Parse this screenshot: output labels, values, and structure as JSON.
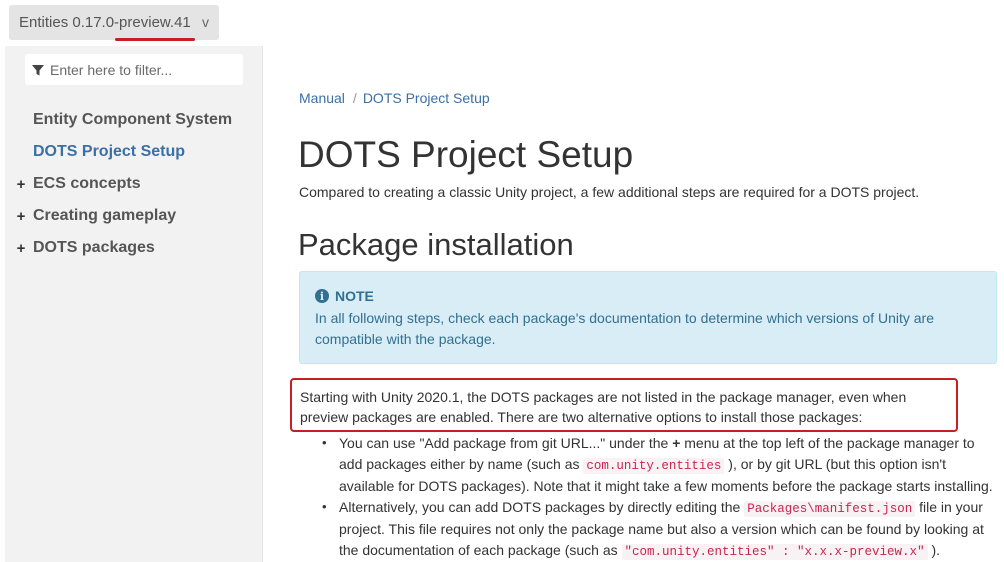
{
  "version_selector": {
    "label": "Entities 0.17.0-preview.41",
    "chevron": "v"
  },
  "sidebar": {
    "filter_placeholder": "Enter here to filter...",
    "items": [
      {
        "label": "Entity Component System",
        "expandable": false,
        "active": false
      },
      {
        "label": "DOTS Project Setup",
        "expandable": false,
        "active": true
      },
      {
        "label": "ECS concepts",
        "expandable": true,
        "active": false
      },
      {
        "label": "Creating gameplay",
        "expandable": true,
        "active": false
      },
      {
        "label": "DOTS packages",
        "expandable": true,
        "active": false
      }
    ],
    "expand_glyph": "+"
  },
  "breadcrumb": {
    "items": [
      "Manual",
      "DOTS Project Setup"
    ],
    "separator": "/"
  },
  "page": {
    "title": "DOTS Project Setup",
    "intro": "Compared to creating a classic Unity project, a few additional steps are required for a DOTS project.",
    "section_title": "Package installation",
    "note": {
      "label": "NOTE",
      "icon_glyph": "i",
      "body": "In all following steps, check each package's documentation to determine which versions of Unity are compatible with the package."
    },
    "highlight_paragraph": "Starting with Unity 2020.1, the DOTS packages are not listed in the package manager, even when preview packages are enabled. There are two alternative options to install those packages:",
    "bullet1": {
      "t1": "You can use \"Add package from git URL...\" under the ",
      "plus": "+",
      "t2": " menu at the top left of the package manager to add packages either by name (such as ",
      "code1": "com.unity.entities",
      "t3": " ), or by git URL (but this option isn't available for DOTS packages). Note that it might take a few moments before the package starts installing."
    },
    "bullet2": {
      "t1": "Alternatively, you can add DOTS packages by directly editing the ",
      "code1": "Packages\\manifest.json",
      "t2": " file in your project. This file requires not only the package name but also a version which can be found by looking at the documentation of each package (such as ",
      "code2": "\"com.unity.entities\" : \"x.x.x-preview.x\"",
      "t3": " )."
    }
  },
  "colors": {
    "link": "#3c6fa4",
    "highlight_border": "#c61e22",
    "note_bg": "#d9edf7",
    "note_text": "#31708f",
    "code_text": "#c7254e"
  },
  "icons": {
    "filter": "funnel-icon",
    "note": "info-circle-icon",
    "expand": "plus-icon",
    "dropdown": "chevron-down-icon"
  }
}
